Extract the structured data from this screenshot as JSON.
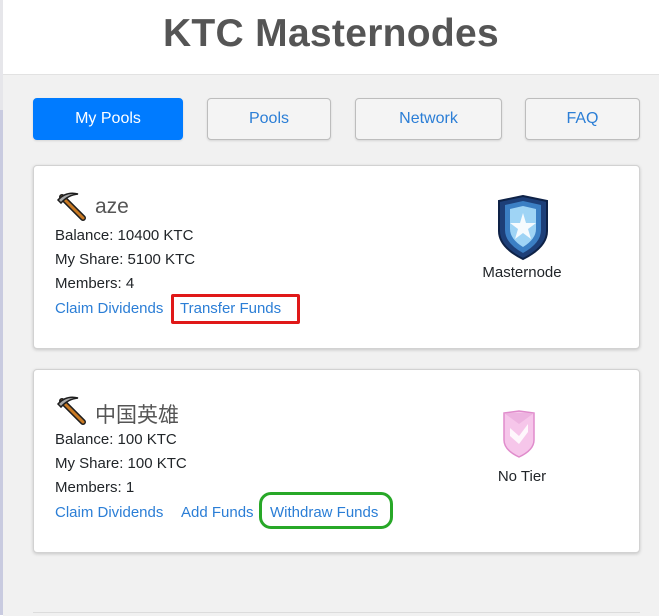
{
  "header": {
    "title": "KTC Masternodes"
  },
  "nav": [
    {
      "label": "My Pools",
      "active": true
    },
    {
      "label": "Pools",
      "active": false
    },
    {
      "label": "Network",
      "active": false
    },
    {
      "label": "FAQ",
      "active": false
    }
  ],
  "pools": [
    {
      "name": "aze",
      "balance": "Balance: 10400 KTC",
      "my_share": "My Share: 5100 KTC",
      "members": "Members: 4",
      "links": [
        "Claim Dividends",
        "Transfer Funds"
      ],
      "tier": "Masternode",
      "tier_icon": "shield-badge-icon"
    },
    {
      "name": "中国英雄",
      "balance": "Balance: 100 KTC",
      "my_share": "My Share: 100 KTC",
      "members": "Members: 1",
      "links": [
        "Claim Dividends",
        "Add Funds",
        "Withdraw Funds"
      ],
      "tier": "No Tier",
      "tier_icon": "pink-chevron-badge-icon"
    }
  ],
  "colors": {
    "accent": "#007bff",
    "link": "#2b7ed6",
    "highlight_red": "#e01818",
    "highlight_green": "#28a828"
  }
}
